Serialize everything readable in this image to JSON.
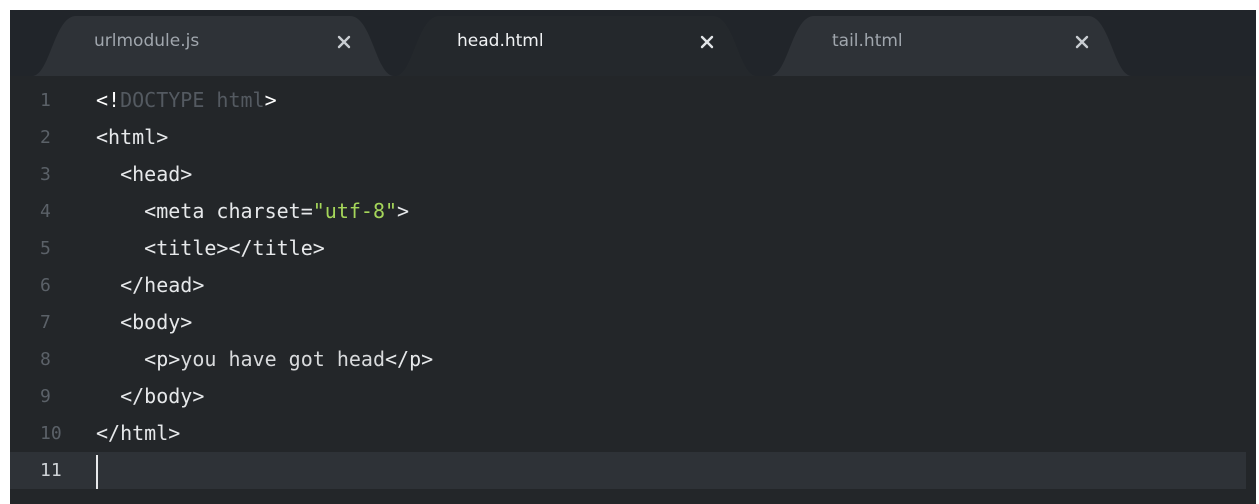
{
  "colors": {
    "tabbar_bg": "#21252a",
    "editor_bg": "#232629",
    "active_tab_bg": "#24282c",
    "inactive_tab_bg": "#2e3237",
    "string_green": "#a5d65a",
    "doctype_grey": "#545a61",
    "line_number": "#5b6168",
    "current_line_bg": "#2e3237"
  },
  "tabs": [
    {
      "label": "urlmodule.js",
      "active": false,
      "close_icon": "close-icon"
    },
    {
      "label": "head.html",
      "active": true,
      "close_icon": "close-icon"
    },
    {
      "label": "tail.html",
      "active": false,
      "close_icon": "close-icon"
    }
  ],
  "editor": {
    "current_line": 11,
    "lines": [
      {
        "number": "1",
        "tokens": [
          {
            "t": "<!",
            "c": "punct"
          },
          {
            "t": "DOCTYPE html",
            "c": "doctype"
          },
          {
            "t": ">",
            "c": "punct"
          }
        ]
      },
      {
        "number": "2",
        "tokens": [
          {
            "t": "<html>",
            "c": "tag"
          }
        ]
      },
      {
        "number": "3",
        "tokens": [
          {
            "t": "  <head>",
            "c": "tag"
          }
        ]
      },
      {
        "number": "4",
        "tokens": [
          {
            "t": "    <meta charset=",
            "c": "tag"
          },
          {
            "t": "\"utf-8\"",
            "c": "str"
          },
          {
            "t": ">",
            "c": "tag"
          }
        ]
      },
      {
        "number": "5",
        "tokens": [
          {
            "t": "    <title></title>",
            "c": "tag"
          }
        ]
      },
      {
        "number": "6",
        "tokens": [
          {
            "t": "  </head>",
            "c": "tag"
          }
        ]
      },
      {
        "number": "7",
        "tokens": [
          {
            "t": "  <body>",
            "c": "tag"
          }
        ]
      },
      {
        "number": "8",
        "tokens": [
          {
            "t": "    <p>",
            "c": "tag"
          },
          {
            "t": "you have got head",
            "c": "text"
          },
          {
            "t": "</p>",
            "c": "tag"
          }
        ]
      },
      {
        "number": "9",
        "tokens": [
          {
            "t": "  </body>",
            "c": "tag"
          }
        ]
      },
      {
        "number": "10",
        "tokens": [
          {
            "t": "</html>",
            "c": "tag"
          }
        ]
      },
      {
        "number": "11",
        "tokens": []
      }
    ]
  }
}
